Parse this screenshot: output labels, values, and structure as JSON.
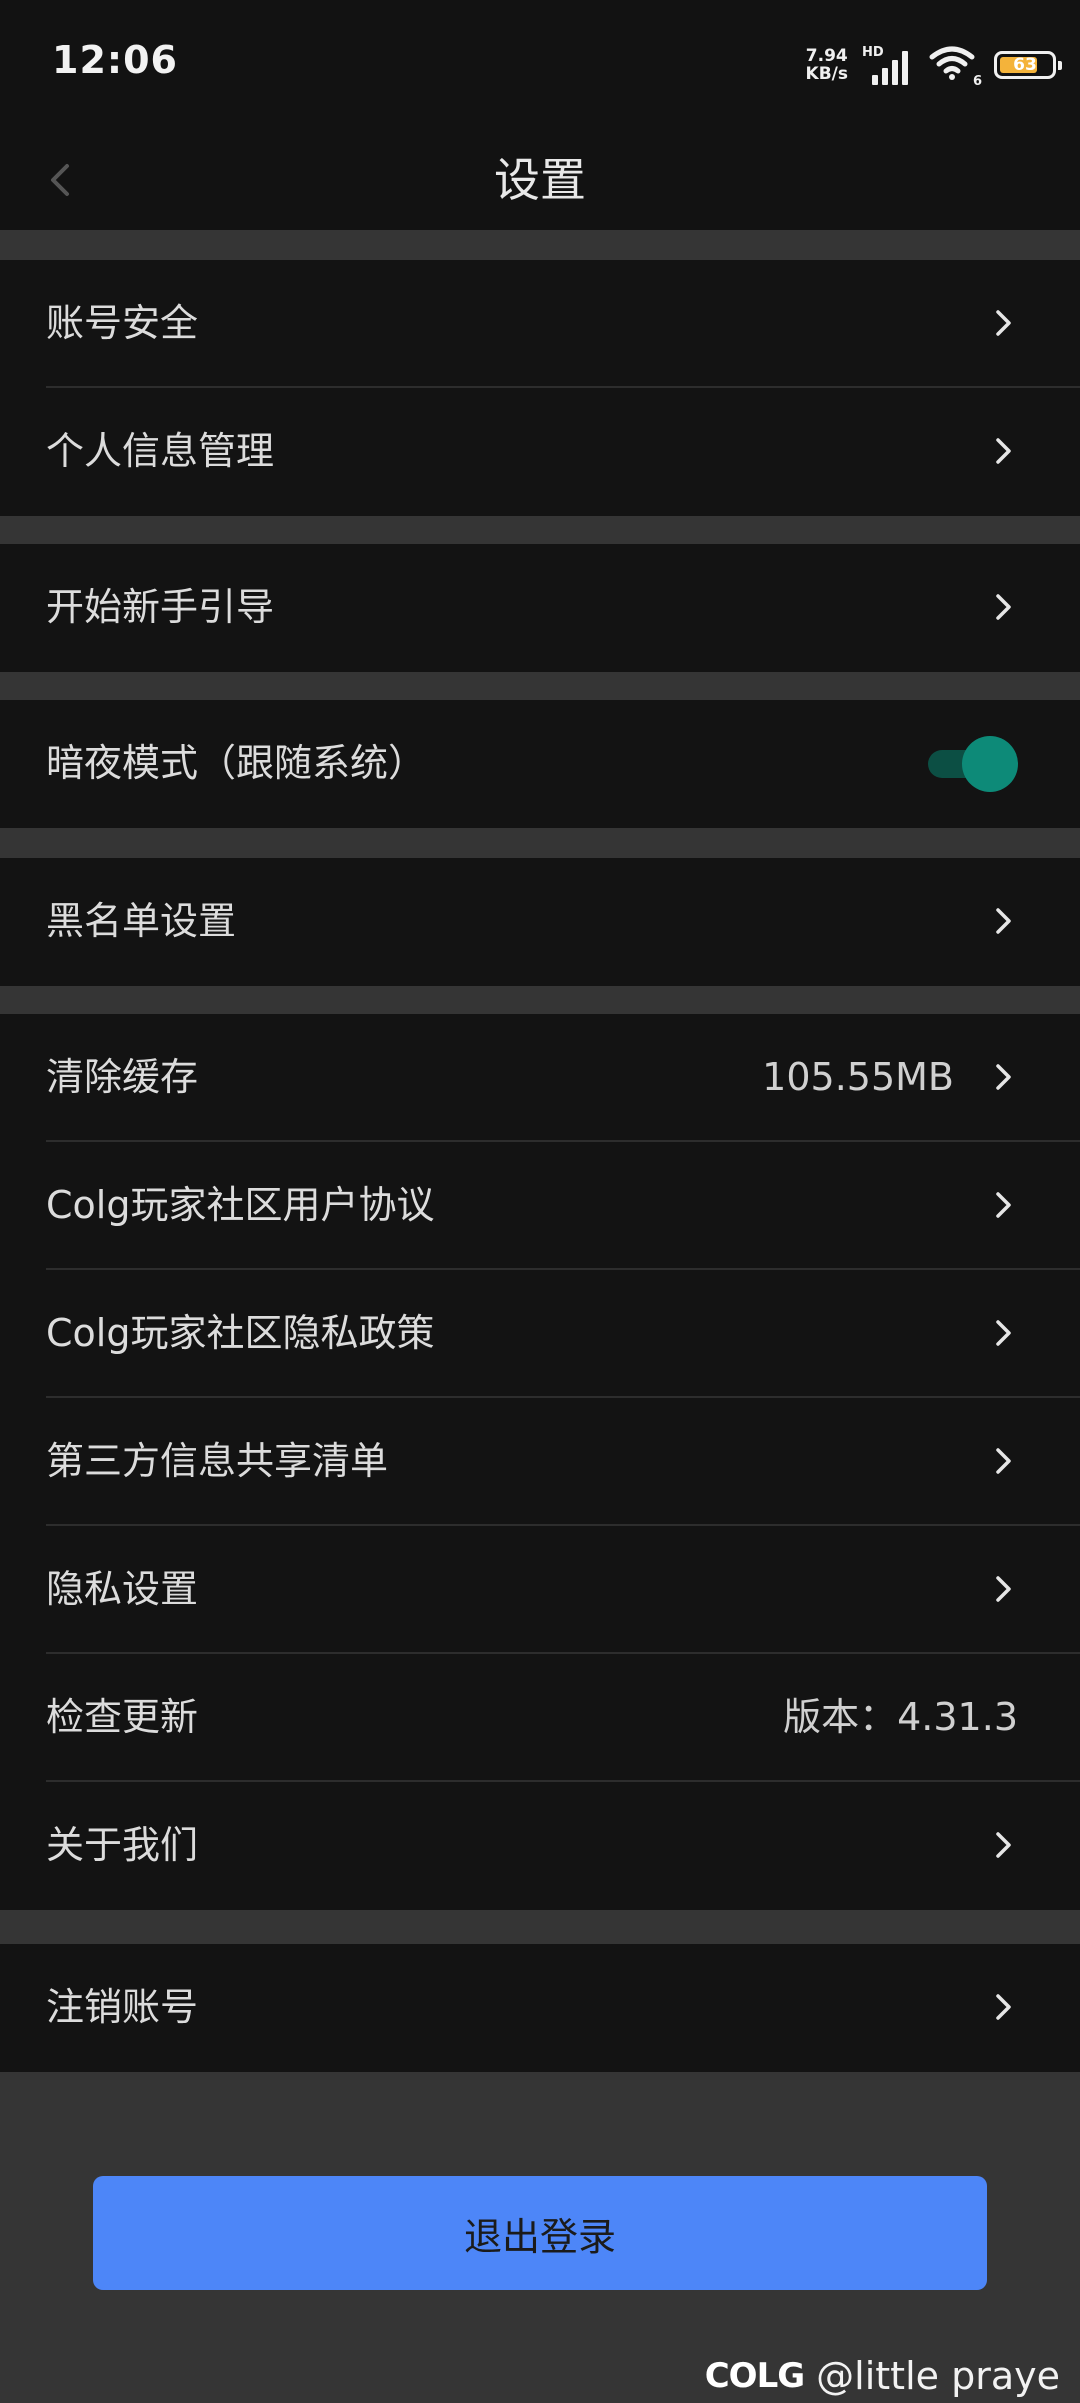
{
  "status_bar": {
    "time": "12:06",
    "net_speed_value": "7.94",
    "net_speed_unit": "KB/s",
    "signal_label": "HD",
    "wifi_label": "6",
    "battery_level": "63"
  },
  "header": {
    "title": "设置"
  },
  "groups": {
    "g1": {
      "account_security": "账号安全",
      "personal_info": "个人信息管理"
    },
    "g2": {
      "beginner_guide": "开始新手引导"
    },
    "g3": {
      "dark_mode": "暗夜模式（跟随系统）",
      "dark_mode_on": true
    },
    "g4": {
      "blacklist": "黑名单设置"
    },
    "g5": {
      "clear_cache": "清除缓存",
      "cache_size": "105.55MB",
      "user_agreement": "Colg玩家社区用户协议",
      "privacy_policy": "Colg玩家社区隐私政策",
      "third_party": "第三方信息共享清单",
      "privacy_settings": "隐私设置",
      "check_update": "检查更新",
      "version": "版本：4.31.3",
      "about_us": "关于我们"
    },
    "g6": {
      "delete_account": "注销账号"
    }
  },
  "logout_label": "退出登录",
  "watermark": {
    "logo_text": "COLG",
    "handle": "@little praye"
  },
  "colors": {
    "accent": "#4d86f8",
    "toggle_on": "#0d8a78",
    "row_bg": "#131313",
    "page_bg": "#353535"
  }
}
